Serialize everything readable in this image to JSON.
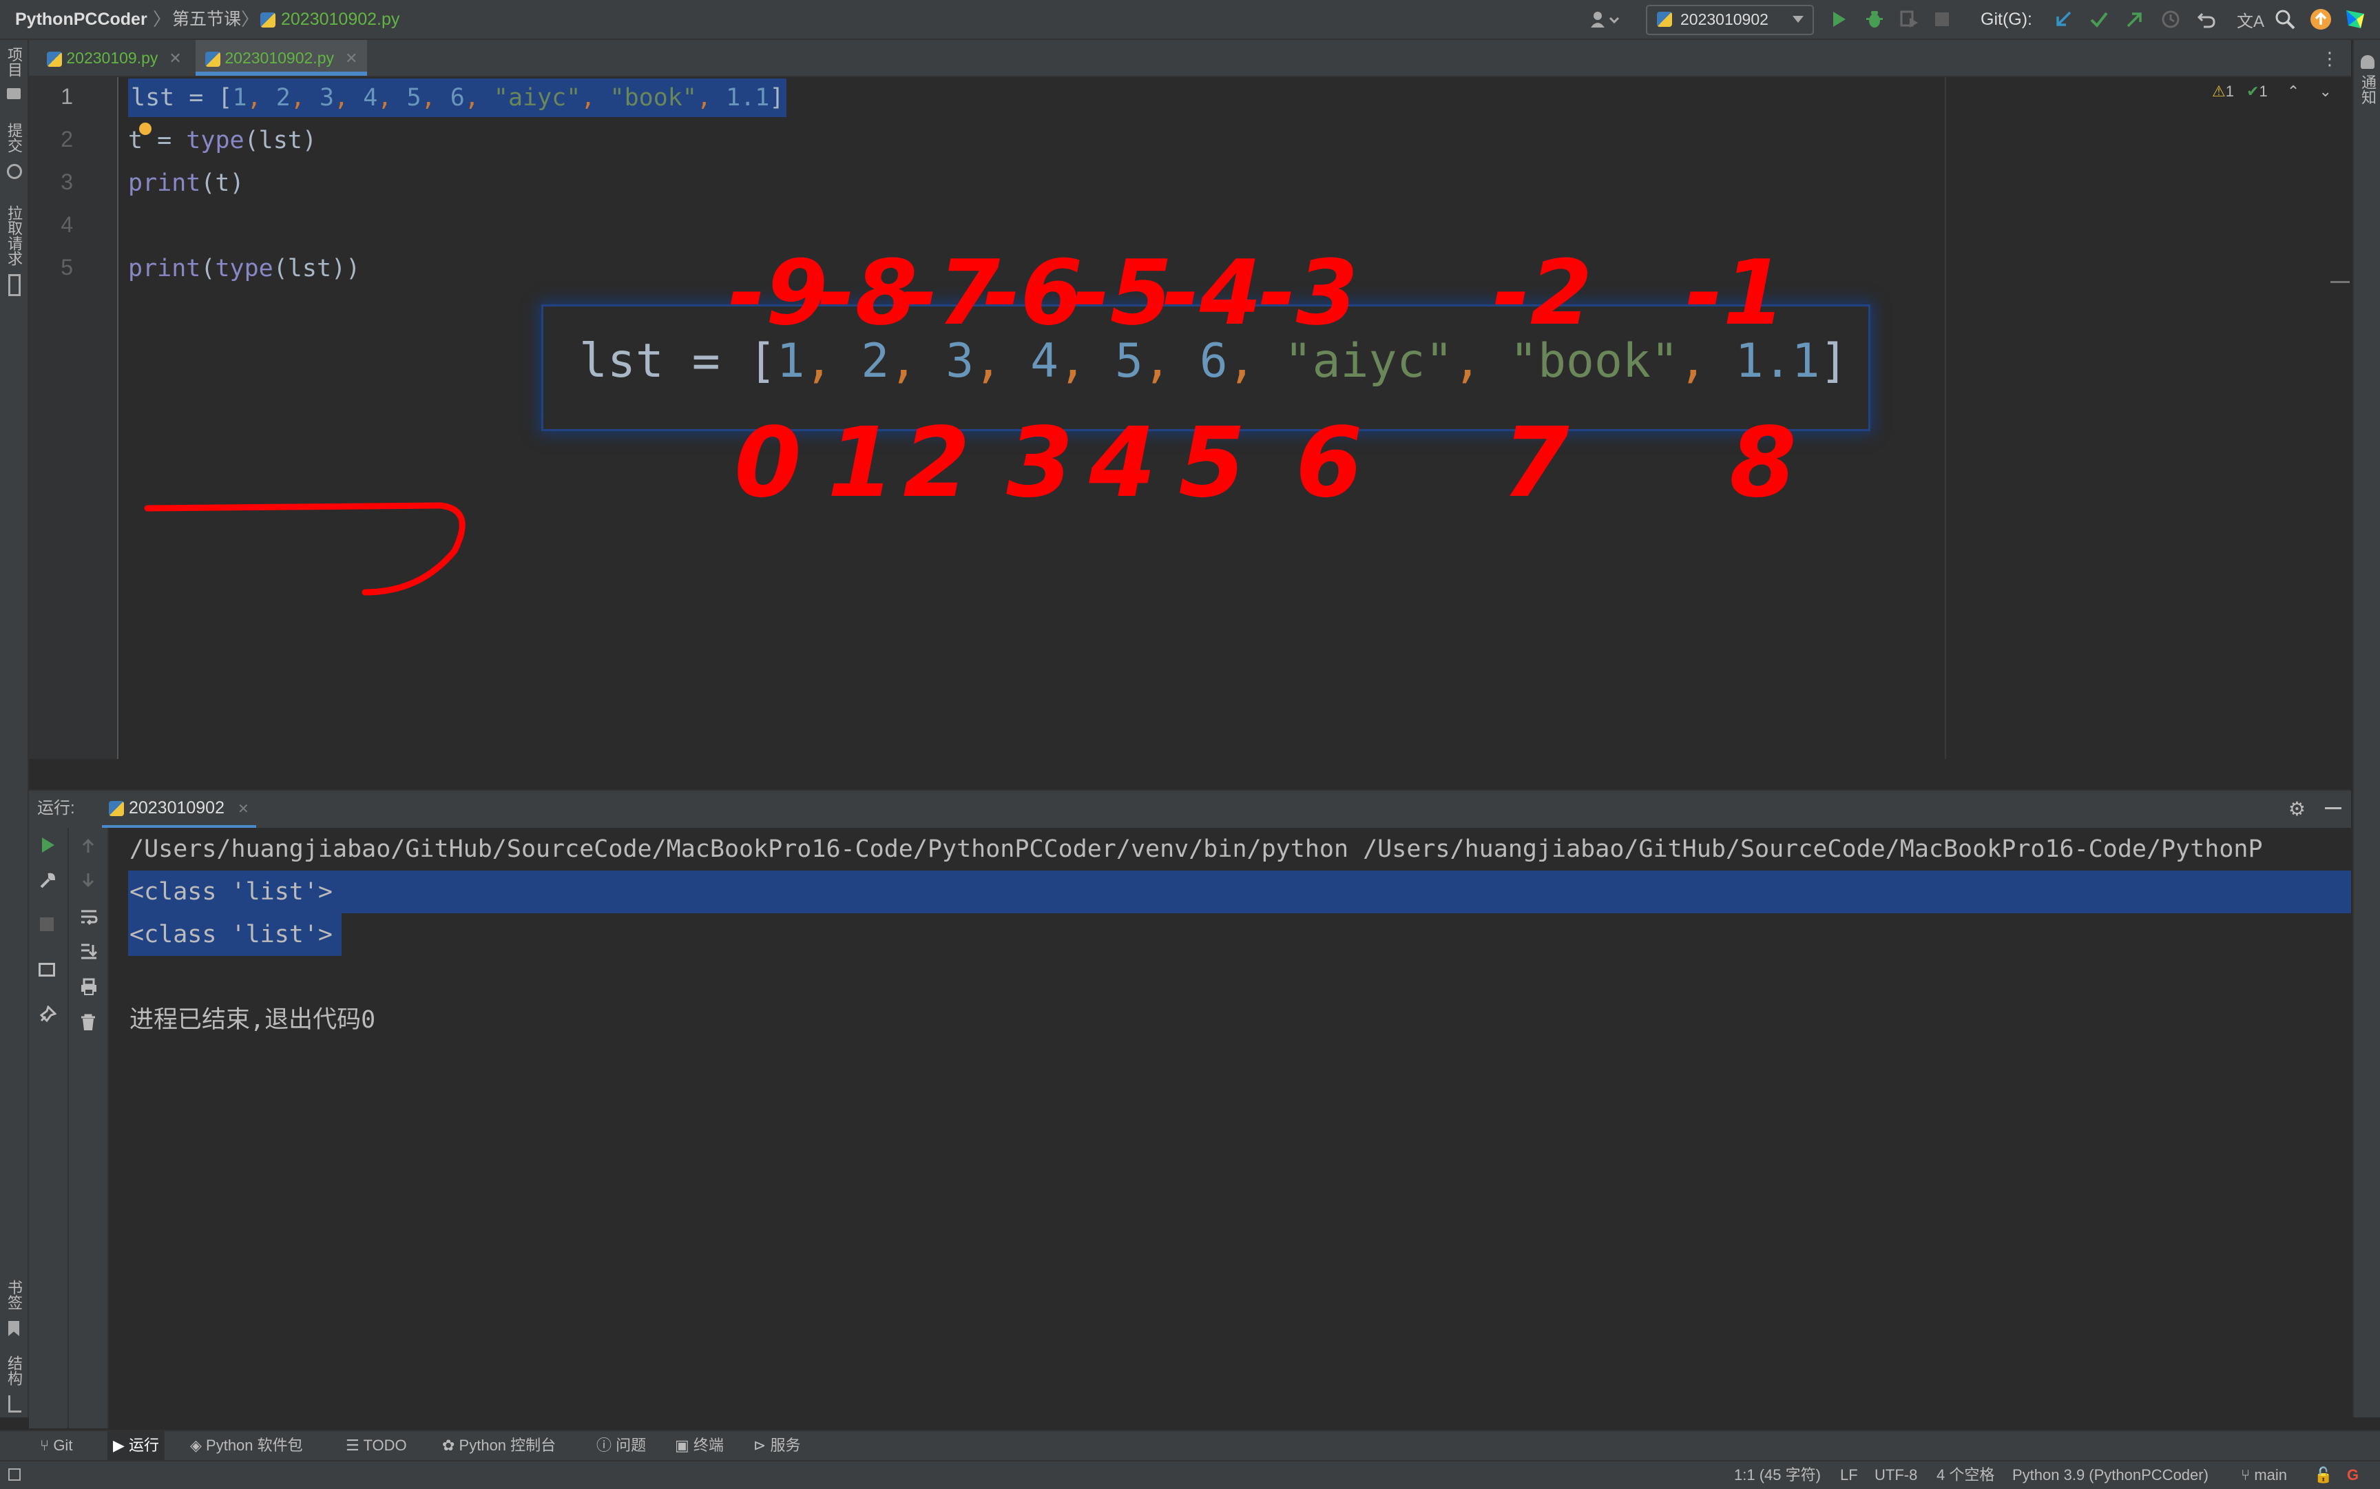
{
  "breadcrumbs": {
    "project": "PythonPCCoder",
    "folder": "第五节课",
    "file": "2023010902.py"
  },
  "toolbar": {
    "run_config": "2023010902",
    "git_label": "Git(G):"
  },
  "left_strip": {
    "project": "项目",
    "commit": "提交",
    "pull_requests": "拉取请求",
    "bookmarks": "书签",
    "structure": "结构"
  },
  "right_strip": {
    "notifications": "通知"
  },
  "tabs": [
    {
      "label": "20230109.py",
      "active": false
    },
    {
      "label": "2023010902.py",
      "active": true
    }
  ],
  "editor": {
    "line_numbers": [
      "1",
      "2",
      "3",
      "4",
      "5"
    ],
    "lines": [
      {
        "pre": "lst = [",
        "items": [
          "1",
          "2",
          "3",
          "4",
          "5",
          "6",
          "\"aiyc\"",
          "\"book\"",
          "1.1"
        ],
        "post": "]"
      },
      "t = type(lst)",
      "print(t)",
      "",
      "print(type(lst))"
    ],
    "inspections": {
      "warnings": "1",
      "ok": "1"
    }
  },
  "zoom_popup": {
    "text": "lst = [1, 2, 3, 4, 5, 6, \"aiyc\", \"book\", 1.1]"
  },
  "annotations": {
    "color": "#ff0000",
    "negative_indices": [
      "-9",
      "-8",
      "-7",
      "-6",
      "-5",
      "-4",
      "-3",
      "-2",
      "-1"
    ],
    "positive_indices": [
      "0",
      "1",
      "2",
      "3",
      "4",
      "5",
      "6",
      "7",
      "8"
    ]
  },
  "run_panel": {
    "label": "运行:",
    "tab_label": "2023010902",
    "output": [
      "/Users/huangjiabao/GitHub/SourceCode/MacBookPro16-Code/PythonPCCoder/venv/bin/python /Users/huangjiabao/GitHub/SourceCode/MacBookPro16-Code/PythonP",
      "<class 'list'>",
      "<class 'list'>",
      "",
      "进程已结束,退出代码0"
    ]
  },
  "bottom_tools": [
    "Git",
    "运行",
    "Python 软件包",
    "TODO",
    "Python 控制台",
    "问题",
    "终端",
    "服务"
  ],
  "status": {
    "position": "1:1 (45 字符)",
    "line_sep": "LF",
    "encoding": "UTF-8",
    "indent": "4 个空格",
    "interpreter": "Python 3.9 (PythonPCCoder)",
    "branch": "main"
  }
}
